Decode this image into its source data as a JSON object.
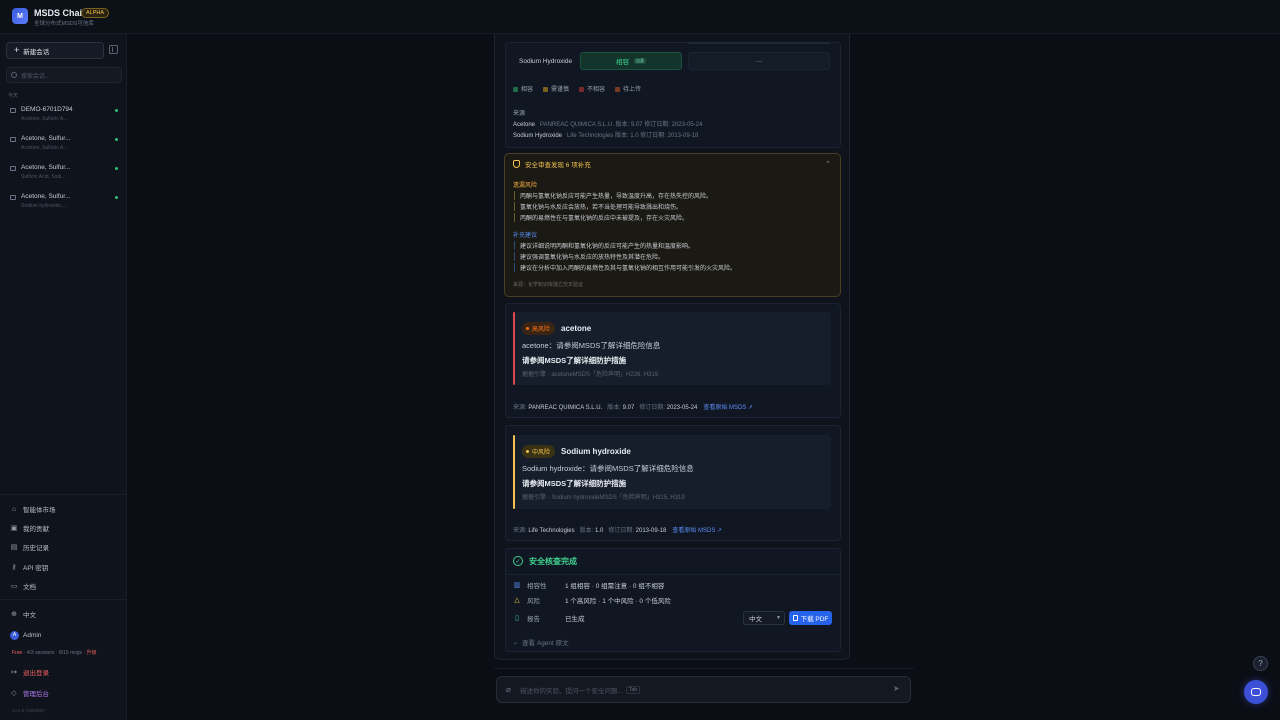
{
  "app": {
    "logo": "M",
    "title": "MSDS Chain",
    "badge": "ALPHA",
    "subtitle": "全球分布式MSDS可信库"
  },
  "sidebar": {
    "new_chat": "新建会话",
    "search_placeholder": "搜索会话...",
    "section": "今天",
    "conversations": [
      {
        "title": "DEMO-6701D794",
        "sub": "Acetone, Sulfuric A..."
      },
      {
        "title": "Acetone, Sulfur...",
        "sub": "Acetone, Sulfuric A..."
      },
      {
        "title": "Acetone, Sulfur...",
        "sub": "Sulfuric Acid, Sodi..."
      },
      {
        "title": "Acetone, Sulfur...",
        "sub": "Sodium hydroxide,..."
      }
    ],
    "nav": [
      "智能体市场",
      "我的贡献",
      "历史记录",
      "API 密钥",
      "文档"
    ],
    "language": "中文",
    "user": {
      "initial": "A",
      "name": "Admin"
    },
    "plan": {
      "tier": "Free",
      "usage": " · 4/3 sessions · 8/15 msgs · ",
      "upgrade": "升级"
    },
    "logout": "退出登录",
    "admin": "管理后台",
    "version": "v0.2.0 (190af80)"
  },
  "compat": {
    "row_label": "Sodium Hydroxide",
    "cell_value": "相容",
    "cell_tag": "自身",
    "dash": "—",
    "legend": [
      {
        "label": "相容",
        "color": "#1f6b4c"
      },
      {
        "label": "需谨慎",
        "color": "#7a6220"
      },
      {
        "label": "不相容",
        "color": "#7a2a2a"
      },
      {
        "label": "待上传",
        "color": "#7a3a22"
      }
    ],
    "sources_title": "来源",
    "sources": [
      {
        "name": "Acetone",
        "detail": "PANREAC QUIMICA S.L.U.   版本: 9.07   修订日期: 2023-05-24"
      },
      {
        "name": "Sodium Hydroxide",
        "detail": "Life Technologies   版本: 1.0   修订日期: 2013-09-18"
      }
    ]
  },
  "review": {
    "title": "安全审查发现 6 项补充",
    "missed_title": "遗漏风险",
    "missed": [
      "丙酮与氢氧化钠反应可能产生热量，导致温度升高，存在热失控的风险。",
      "氢氧化钠与水反应会放热，若不当处理可能导致溅出和烧伤。",
      "丙酮的易燃性在与氢氧化钠的反应中未被提及，存在火灾风险。"
    ],
    "suggest_title": "补充建议",
    "suggest": [
      "建议详细说明丙酮和氢氧化钠的反应可能产生的热量和温度影响。",
      "建议强调氢氧化钠与水反应的放热特性及其潜在危险。",
      "建议在分析中加入丙酮的易燃性及其与氢氧化钠的相互作用可能引发的火灾风险。"
    ],
    "footer": "来源：化学知识库独立交叉验证"
  },
  "risks": [
    {
      "level": "高风险",
      "name": "acetone",
      "line1": "acetone：请参阅MSDS了解详细危险信息",
      "line2": "请参阅MSDS了解详细防护措施",
      "cite": "据据引擎 · acetoneMSDS「危险声明」H226, H319",
      "meta_src_label": "来源: ",
      "meta_src": "PANREAC QUIMICA S.L.U.",
      "meta_ver_label": "版本: ",
      "meta_ver": "9.07",
      "meta_date_label": "修订日期: ",
      "meta_date": "2023-05-24",
      "link": "查看原始 MSDS ↗"
    },
    {
      "level": "中风险",
      "name": "Sodium hydroxide",
      "line1": "Sodium hydroxide：请参阅MSDS了解详细危险信息",
      "line2": "请参阅MSDS了解详细防护措施",
      "cite": "据据引擎 · Sodium hydroxideMSDS「危险声明」H315, H319",
      "meta_src_label": "来源: ",
      "meta_src": "Life Technologies",
      "meta_ver_label": "版本: ",
      "meta_ver": "1.0",
      "meta_date_label": "修订日期: ",
      "meta_date": "2013-09-18",
      "link": "查看原始 MSDS ↗"
    }
  ],
  "done": {
    "title": "安全核查完成",
    "rows": [
      {
        "key": "相容性",
        "value": "1 组相容 · 0 组需注意 · 0 组不相容"
      },
      {
        "key": "风险",
        "value": "1 个高风险 · 1 个中风险 · 0 个低风险"
      },
      {
        "key": "报告",
        "value": "已生成"
      }
    ],
    "lang": "中文",
    "pdf": "下载 PDF",
    "agent_toggle": "查看 Agent 原文"
  },
  "composer": {
    "placeholder": "描述你的实验、提问一个安全问题...",
    "kbd": "Tab"
  },
  "colors": {
    "accent": "#2563eb",
    "high": "#f97316",
    "high_bar": "#e0474c",
    "mid": "#f2c14e",
    "ok": "#3fd18e"
  }
}
